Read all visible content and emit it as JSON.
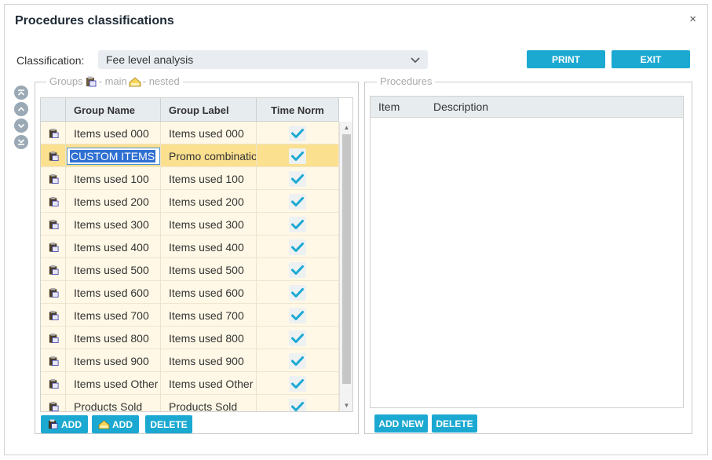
{
  "dialog": {
    "title": "Procedures classifications",
    "close_symbol": "×"
  },
  "classification": {
    "label": "Classification:",
    "value": "Fee level analysis"
  },
  "buttons": {
    "print": "PRINT",
    "exit": "EXIT"
  },
  "groups": {
    "legend_prefix": "Groups",
    "legend_main": "- main",
    "legend_nested": "- nested",
    "columns": {
      "name": "Group Name",
      "label": "Group Label",
      "time": "Time Norm"
    },
    "rows": [
      {
        "name": "Items used 000",
        "label": "Items used 000",
        "time_norm": true
      },
      {
        "name": "CUSTOM ITEMS",
        "label": "Promo combination",
        "time_norm": true
      },
      {
        "name": "Items used 100",
        "label": "Items used 100",
        "time_norm": true
      },
      {
        "name": "Items used 200",
        "label": "Items used 200",
        "time_norm": true
      },
      {
        "name": "Items used 300",
        "label": "Items used 300",
        "time_norm": true
      },
      {
        "name": "Items used 400",
        "label": "Items used 400",
        "time_norm": true
      },
      {
        "name": "Items used 500",
        "label": "Items used 500",
        "time_norm": true
      },
      {
        "name": "Items used 600",
        "label": "Items used 600",
        "time_norm": true
      },
      {
        "name": "Items used 700",
        "label": "Items used 700",
        "time_norm": true
      },
      {
        "name": "Items used 800",
        "label": "Items used 800",
        "time_norm": true
      },
      {
        "name": "Items used 900",
        "label": "Items used 900",
        "time_norm": true
      },
      {
        "name": "Items used Other",
        "label": "Items used Other",
        "time_norm": true
      },
      {
        "name": "Products Sold",
        "label": "Products Sold",
        "time_norm": true
      }
    ],
    "buttons": {
      "add_main": "ADD",
      "add_nested": "ADD",
      "delete": "DELETE"
    }
  },
  "procedures": {
    "legend": "Procedures",
    "columns": {
      "item": "Item",
      "description": "Description"
    },
    "buttons": {
      "add_new": "ADD NEW",
      "delete": "DELETE"
    }
  },
  "colors": {
    "accent": "#1ba9d2",
    "row_bg": "#fff8e6",
    "row_selected": "#fbe08f",
    "check": "#1ba9d2"
  },
  "icons": [
    "close-icon",
    "chevron-down-icon",
    "move-top-icon",
    "move-up-icon",
    "move-down-icon",
    "move-bottom-icon",
    "main-group-icon",
    "nested-group-icon",
    "check-icon"
  ]
}
